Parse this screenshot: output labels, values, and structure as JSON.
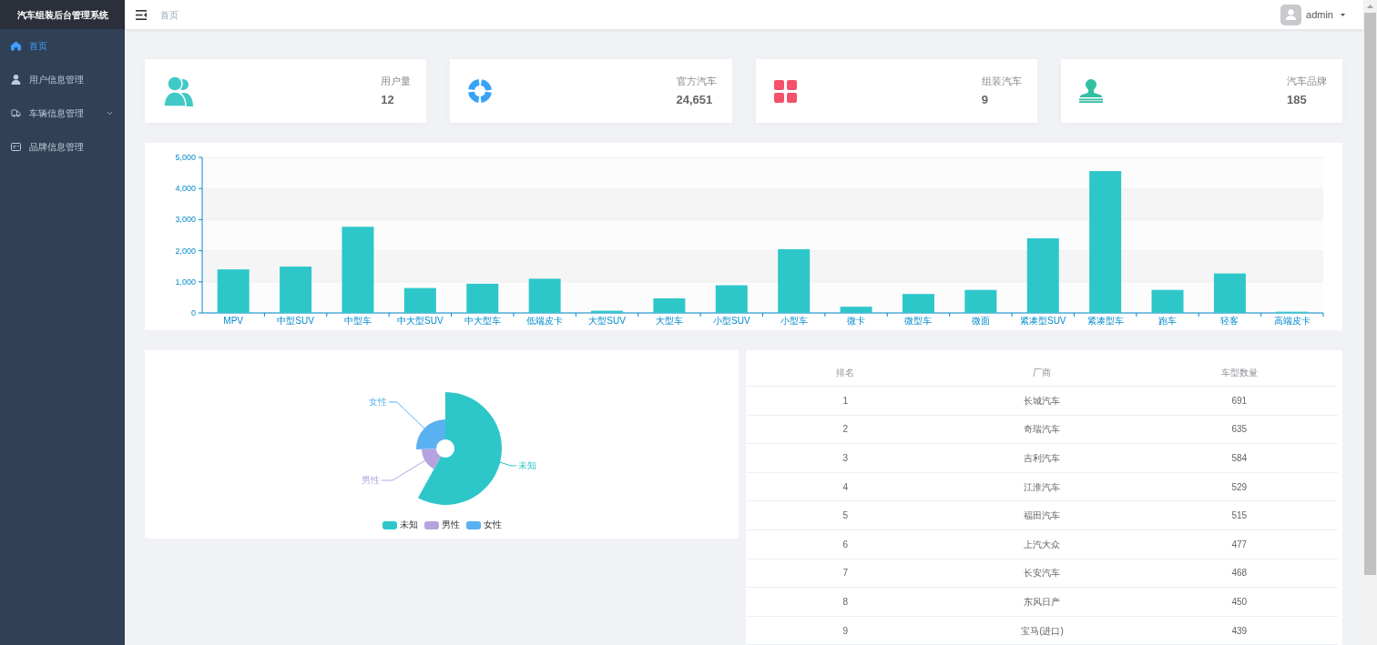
{
  "sidebar": {
    "title": "汽车组装后台管理系统",
    "items": [
      {
        "label": "首页",
        "selected": true,
        "kind": "link"
      },
      {
        "label": "用户信息管理",
        "selected": false,
        "kind": "link"
      },
      {
        "label": "车辆信息管理",
        "selected": false,
        "kind": "submenu"
      },
      {
        "label": "品牌信息管理",
        "selected": false,
        "kind": "link"
      }
    ]
  },
  "navbar": {
    "breadcrumb": "首页",
    "user": "admin"
  },
  "stats": [
    {
      "label": "用户量",
      "value": "12",
      "color": "#40c9c6"
    },
    {
      "label": "官方汽车",
      "value": "24,651",
      "color": "#36a3f7"
    },
    {
      "label": "组装汽车",
      "value": "9",
      "color": "#f4516c"
    },
    {
      "label": "汽车品牌",
      "value": "185",
      "color": "#34bfa3"
    }
  ],
  "bar_chart": {
    "chart_data": {
      "type": "bar",
      "categories": [
        "MPV",
        "中型SUV",
        "中型车",
        "中大型SUV",
        "中大型车",
        "低端皮卡",
        "大型SUV",
        "大型车",
        "小型SUV",
        "小型车",
        "微卡",
        "微型车",
        "微面",
        "紧凑型SUV",
        "紧凑型车",
        "跑车",
        "轻客",
        "高端皮卡"
      ],
      "series": [
        {
          "color": "#2ec7c9",
          "values": [
            1400,
            1490,
            2770,
            800,
            940,
            1100,
            70,
            470,
            890,
            2050,
            200,
            610,
            740,
            2400,
            4560,
            740,
            1270,
            40
          ]
        }
      ],
      "ylim": [
        0,
        5000
      ],
      "yticks": [
        {
          "value": 0,
          "label": "0"
        },
        {
          "value": 1000,
          "label": "1,000"
        },
        {
          "value": 2000,
          "label": "2,000"
        },
        {
          "value": 3000,
          "label": "3,000"
        },
        {
          "value": 4000,
          "label": "4,000"
        },
        {
          "value": 5000,
          "label": "5,000"
        }
      ],
      "grid": true
    }
  },
  "pie": {
    "slices": [
      {
        "label": "未知",
        "color": "#2ec7c9"
      },
      {
        "label": "男性",
        "color": "#b6a2de"
      },
      {
        "label": "女性",
        "color": "#5ab1ef"
      }
    ],
    "legend": [
      {
        "label": "未知",
        "color": "#2ec7c9"
      },
      {
        "label": "男性",
        "color": "#b6a2de"
      },
      {
        "label": "女性",
        "color": "#5ab1ef"
      }
    ]
  },
  "table": {
    "columns": [
      "排名",
      "厂商",
      "车型数量"
    ],
    "rows": [
      [
        "1",
        "长城汽车",
        "691"
      ],
      [
        "2",
        "奇瑞汽车",
        "635"
      ],
      [
        "3",
        "吉利汽车",
        "584"
      ],
      [
        "4",
        "江淮汽车",
        "529"
      ],
      [
        "5",
        "福田汽车",
        "515"
      ],
      [
        "6",
        "上汽大众",
        "477"
      ],
      [
        "7",
        "长安汽车",
        "468"
      ],
      [
        "8",
        "东风日产",
        "450"
      ],
      [
        "9",
        "宝马(进口)",
        "439"
      ]
    ]
  }
}
